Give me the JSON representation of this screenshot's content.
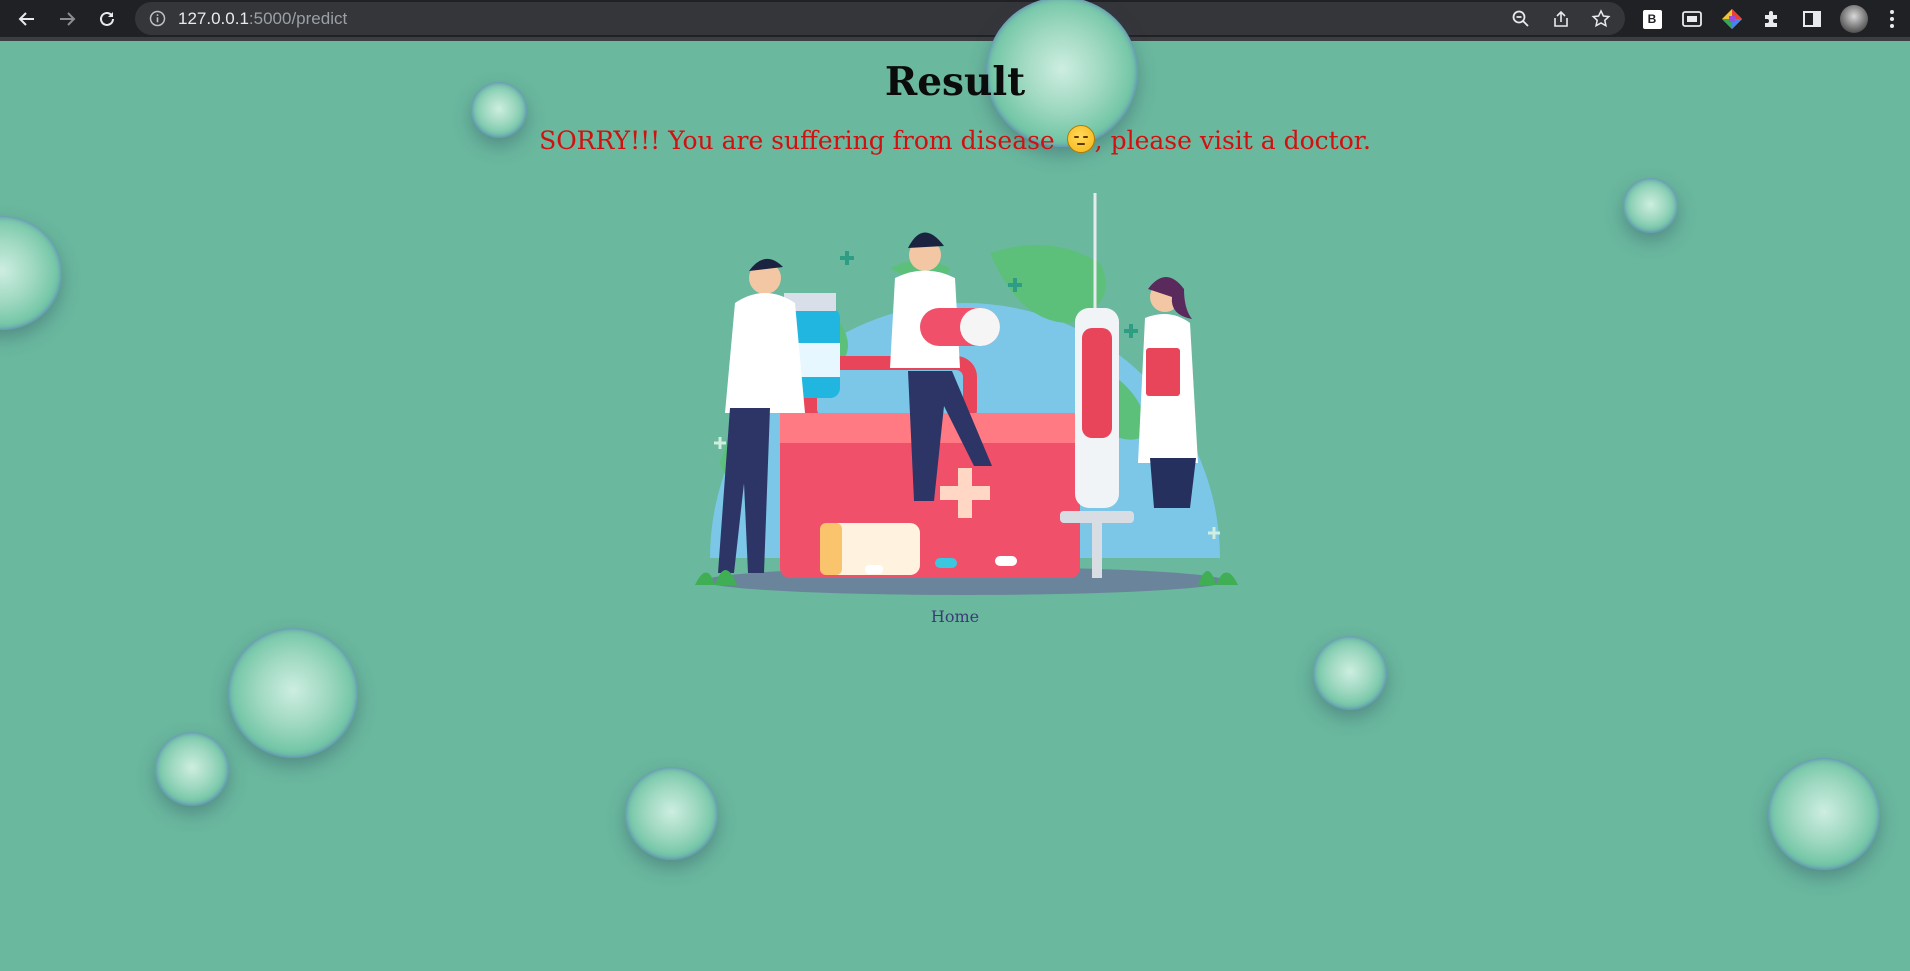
{
  "browser": {
    "url_host": "127.0.0.1",
    "url_path": ":5000/predict",
    "icons": [
      "back-icon",
      "forward-icon",
      "reload-icon",
      "info-icon",
      "zoom-icon",
      "share-icon",
      "bookmark-star-icon",
      "extension-b-icon",
      "picture-in-picture-icon",
      "color-picker-icon",
      "extensions-puzzle-icon",
      "side-panel-icon",
      "profile-avatar",
      "menu-kebab-icon"
    ],
    "extension_b_label": "B"
  },
  "page": {
    "title": "Result",
    "message_before": "SORRY!!! You are suffering from disease ",
    "message_after": ", please visit a doctor.",
    "emoji": "pensive-face",
    "home_link": "Home"
  },
  "colors": {
    "background": "#6ab89e",
    "message": "#d21010",
    "link": "#3c3a78",
    "bubble_rim": "#6a52dc"
  }
}
